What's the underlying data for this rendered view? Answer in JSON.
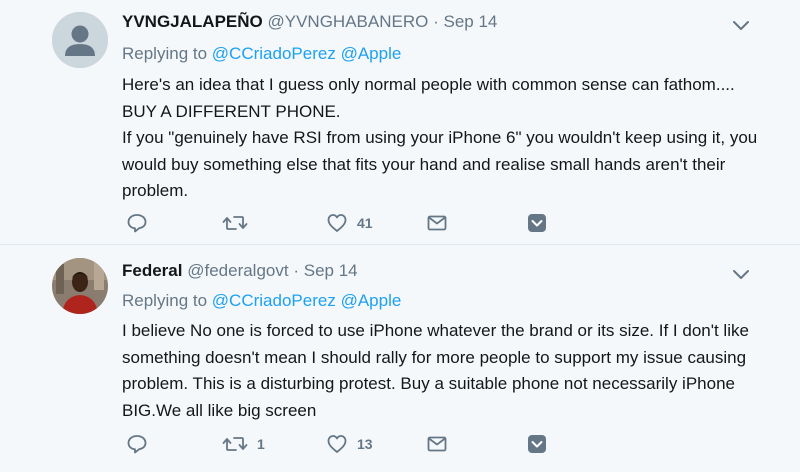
{
  "tweets": [
    {
      "name": "YVNGJALAPEÑO",
      "handle": "@YVNGHABANERO",
      "separator": "·",
      "date": "Sep 14",
      "replying_prefix": "Replying to",
      "mentions": [
        "@CCriadoPerez",
        "@Apple"
      ],
      "body_lines": [
        "Here's an idea that I guess only normal people with common sense can fathom.... BUY A DIFFERENT PHONE.",
        "If you \"genuinely have RSI from using your iPhone 6\" you wouldn't keep using it, you would buy something else that fits your hand and realise small hands aren't their problem."
      ],
      "counts": {
        "reply": "",
        "retweet": "",
        "like": "41"
      },
      "icons": [
        "reply-icon",
        "retweet-icon",
        "like-icon",
        "dm-icon",
        "tweet-action-menu-icon",
        "caret-down-icon"
      ]
    },
    {
      "name": "Federal",
      "handle": "@federalgovt",
      "separator": "·",
      "date": "Sep 14",
      "replying_prefix": "Replying to",
      "mentions": [
        "@CCriadoPerez",
        "@Apple"
      ],
      "body_lines": [
        "I believe No one is forced to use iPhone whatever the brand or its size. If I don't like something doesn't mean I should rally for more people to support my issue causing problem. This is a disturbing protest. Buy a suitable phone not necessarily iPhone BIG.We all like big screen"
      ],
      "counts": {
        "reply": "",
        "retweet": "1",
        "like": "13"
      },
      "icons": [
        "reply-icon",
        "retweet-icon",
        "like-icon",
        "dm-icon",
        "tweet-action-menu-icon",
        "caret-down-icon"
      ]
    }
  ],
  "colors": {
    "background": "#f5f8fa",
    "text": "#14171a",
    "secondary_text": "#657786",
    "link": "#1da1f2",
    "divider": "#e1e8ed",
    "icon": "#657786"
  }
}
